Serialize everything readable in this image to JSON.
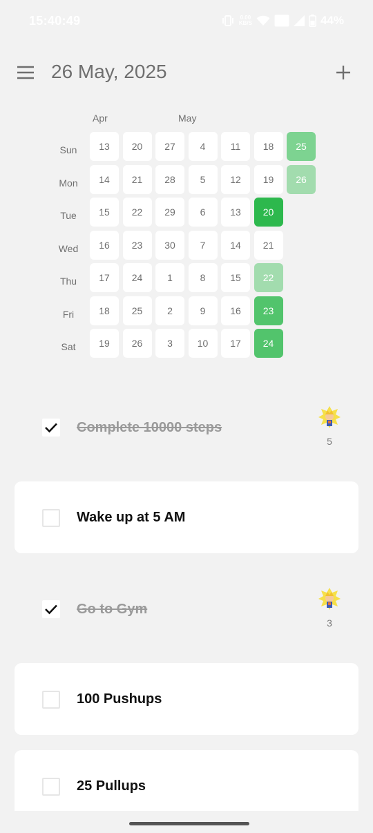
{
  "status_bar": {
    "time": "15:40:49",
    "net_speed_value": "0.00",
    "net_speed_unit": "KB/S",
    "battery_percent": "44%",
    "icons": [
      "vibrate-icon",
      "wifi-icon",
      "volte-icon",
      "signal-icon",
      "battery-icon"
    ]
  },
  "header": {
    "title": "26 May, 2025",
    "menu_icon": "hamburger-menu-icon",
    "add_icon": "plus-icon"
  },
  "calendar": {
    "months": [
      "Apr",
      "May"
    ],
    "weekdays": [
      "Sun",
      "Mon",
      "Tue",
      "Wed",
      "Thu",
      "Fri",
      "Sat"
    ],
    "columns": [
      [
        {
          "d": "13"
        },
        {
          "d": "14"
        },
        {
          "d": "15"
        },
        {
          "d": "16"
        },
        {
          "d": "17"
        },
        {
          "d": "18"
        },
        {
          "d": "19"
        }
      ],
      [
        {
          "d": "20"
        },
        {
          "d": "21"
        },
        {
          "d": "22"
        },
        {
          "d": "23"
        },
        {
          "d": "24"
        },
        {
          "d": "25"
        },
        {
          "d": "26"
        }
      ],
      [
        {
          "d": "27"
        },
        {
          "d": "28"
        },
        {
          "d": "29"
        },
        {
          "d": "30"
        },
        {
          "d": "1"
        },
        {
          "d": "2"
        },
        {
          "d": "3"
        }
      ],
      [
        {
          "d": "4"
        },
        {
          "d": "5"
        },
        {
          "d": "6"
        },
        {
          "d": "7"
        },
        {
          "d": "8"
        },
        {
          "d": "9"
        },
        {
          "d": "10"
        }
      ],
      [
        {
          "d": "11"
        },
        {
          "d": "12"
        },
        {
          "d": "13"
        },
        {
          "d": "14"
        },
        {
          "d": "15"
        },
        {
          "d": "16"
        },
        {
          "d": "17"
        }
      ],
      [
        {
          "d": "18"
        },
        {
          "d": "19"
        },
        {
          "d": "20",
          "level": "strong"
        },
        {
          "d": "21"
        },
        {
          "d": "22",
          "level": "pale"
        },
        {
          "d": "23",
          "level": "mid"
        },
        {
          "d": "24",
          "level": "mid"
        }
      ],
      [
        {
          "d": "25",
          "level": "soft"
        },
        {
          "d": "26",
          "level": "pale"
        }
      ]
    ],
    "colors": {
      "strong": "#2db84d",
      "mid": "#52c46c",
      "soft": "#7dd391",
      "pale": "#a2dcae",
      "empty": "#ffffff"
    }
  },
  "habits": [
    {
      "label": "Complete 10000 steps",
      "checked": true,
      "streak": "5",
      "streak_icon": "super-saiyan-avatar-icon"
    },
    {
      "label": "Wake up at 5 AM",
      "checked": false
    },
    {
      "label": "Go to Gym",
      "checked": true,
      "streak": "3",
      "streak_icon": "super-saiyan-avatar-icon"
    },
    {
      "label": "100 Pushups",
      "checked": false
    },
    {
      "label": "25 Pullups",
      "checked": false
    }
  ]
}
